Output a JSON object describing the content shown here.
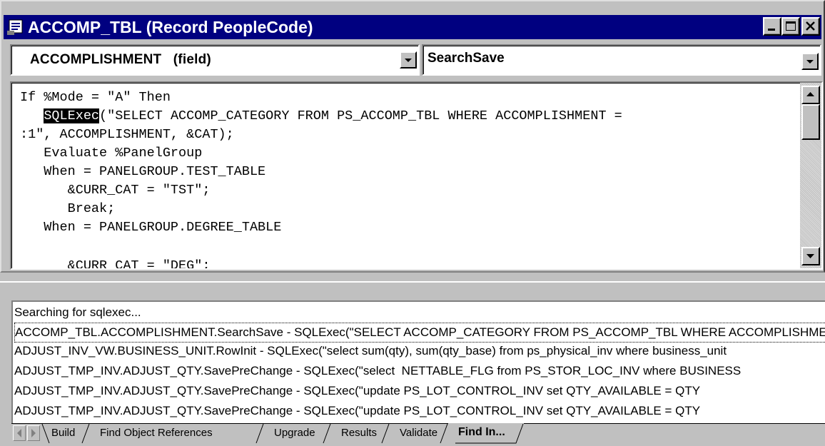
{
  "window": {
    "title": "ACCOMP_TBL (Record PeopleCode)",
    "icon": "peoplecode-document-icon"
  },
  "selectors": {
    "field": "ACCOMPLISHMENT   (field)",
    "event": "SearchSave"
  },
  "code": {
    "lines": [
      "If %Mode = \"A\" Then",
      "   SQLExec(\"SELECT ACCOMP_CATEGORY FROM PS_ACCOMP_TBL WHERE ACCOMPLISHMENT =",
      ":1\", ACCOMPLISHMENT, &CAT);",
      "   Evaluate %PanelGroup",
      "   When = PANELGROUP.TEST_TABLE",
      "      &CURR_CAT = \"TST\";",
      "      Break;",
      "   When = PANELGROUP.DEGREE_TABLE",
      "      &CURR_CAT = \"DEG\";"
    ],
    "highlight_word": "SQLExec",
    "line1_rest": "(\"SELECT ACCOMP_CATEGORY FROM PS_ACCOMP_TBL WHERE ACCOMPLISHMENT ="
  },
  "output": {
    "rows": [
      "Searching for sqlexec...",
      "ACCOMP_TBL.ACCOMPLISHMENT.SearchSave - SQLExec(\"SELECT ACCOMP_CATEGORY FROM PS_ACCOMP_TBL WHERE ACCOMPLISHMENT",
      "ADJUST_INV_VW.BUSINESS_UNIT.RowInit - SQLExec(\"select sum(qty), sum(qty_base) from ps_physical_inv where business_unit",
      "ADJUST_TMP_INV.ADJUST_QTY.SavePreChange - SQLExec(\"select  NETTABLE_FLG from PS_STOR_LOC_INV where BUSINESS",
      "ADJUST_TMP_INV.ADJUST_QTY.SavePreChange - SQLExec(\"update PS_LOT_CONTROL_INV set QTY_AVAILABLE = QTY",
      "ADJUST_TMP_INV.ADJUST_QTY.SavePreChange - SQLExec(\"update PS_LOT_CONTROL_INV set QTY_AVAILABLE = QTY"
    ]
  },
  "tabs": [
    {
      "label": "Build",
      "active": false
    },
    {
      "label": "Find Object References",
      "active": false
    },
    {
      "label": "Upgrade",
      "active": false
    },
    {
      "label": "Results",
      "active": false
    },
    {
      "label": "Validate",
      "active": false
    },
    {
      "label": "Find In...",
      "active": true
    }
  ],
  "colors": {
    "titlebar": "#000080",
    "face": "#c0c0c0",
    "highlight": "#000000"
  }
}
